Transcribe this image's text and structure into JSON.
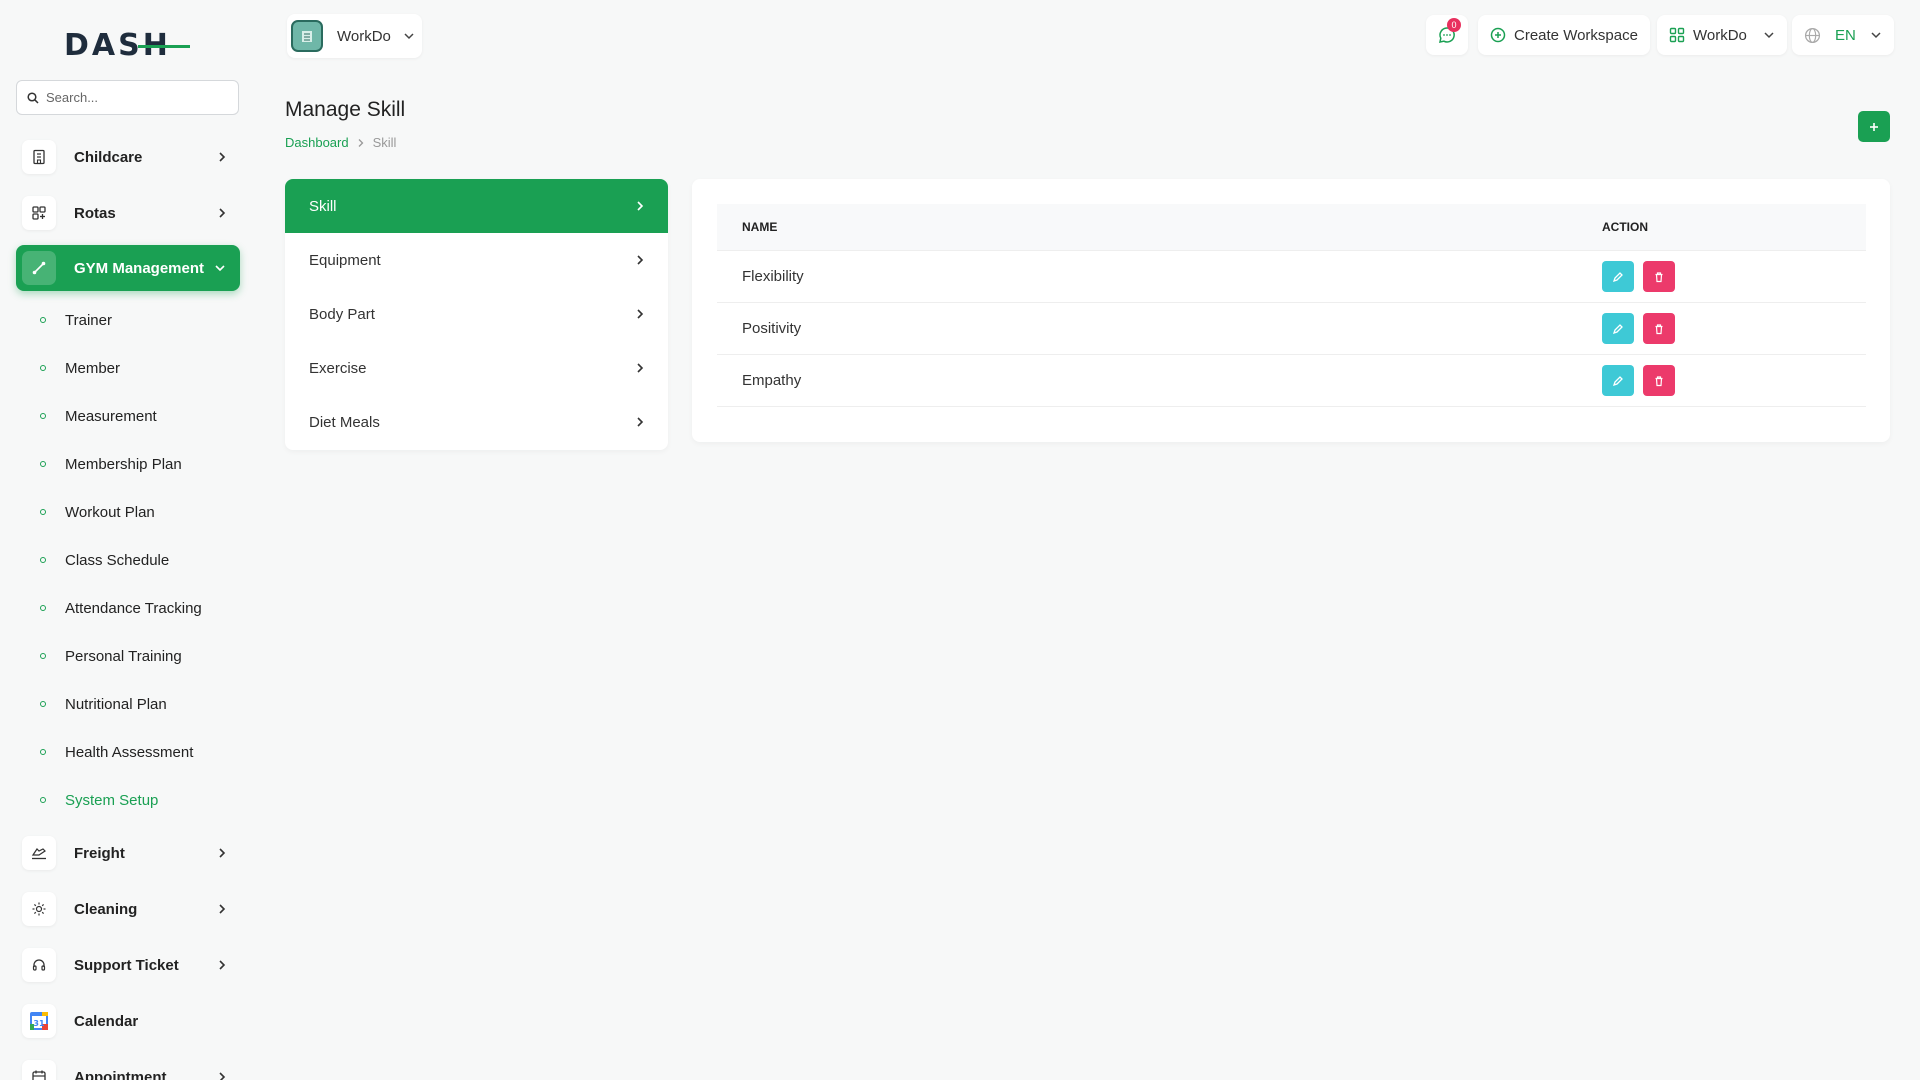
{
  "app": {
    "logo_text": "DASH"
  },
  "search": {
    "placeholder": "Search..."
  },
  "sidebar": {
    "top_items": [
      {
        "label": "Childcare",
        "icon": "building-icon"
      },
      {
        "label": "Rotas",
        "icon": "grid-icon"
      },
      {
        "label": "GYM Management",
        "icon": "dumbbell-icon"
      }
    ],
    "sub_items": [
      "Trainer",
      "Member",
      "Measurement",
      "Membership Plan",
      "Workout Plan",
      "Class Schedule",
      "Attendance Tracking",
      "Personal Training",
      "Nutritional Plan",
      "Health Assessment",
      "System Setup"
    ],
    "bottom_items": [
      {
        "label": "Freight",
        "icon": "freight-icon"
      },
      {
        "label": "Cleaning",
        "icon": "cleaning-icon"
      },
      {
        "label": "Support Ticket",
        "icon": "headset-icon"
      },
      {
        "label": "Calendar",
        "icon": "calendar-icon",
        "calendar_day": "31"
      },
      {
        "label": "Appointment",
        "icon": "appointment-icon"
      }
    ]
  },
  "topbar": {
    "workspace_name": "WorkDo",
    "notification_count": "0",
    "create_workspace_label": "Create Workspace",
    "workspace_dropdown": "WorkDo",
    "language": "EN"
  },
  "page": {
    "title": "Manage Skill",
    "breadcrumb": [
      "Dashboard",
      "Skill"
    ]
  },
  "setup_menu": [
    "Skill",
    "Equipment",
    "Body Part",
    "Exercise",
    "Diet Meals"
  ],
  "table": {
    "headers": [
      "NAME",
      "ACTION"
    ],
    "rows": [
      "Flexibility",
      "Positivity",
      "Empathy"
    ]
  },
  "colors": {
    "accent": "#1aa053",
    "edit": "#3ec9d6",
    "delete": "#ec3a6b"
  }
}
